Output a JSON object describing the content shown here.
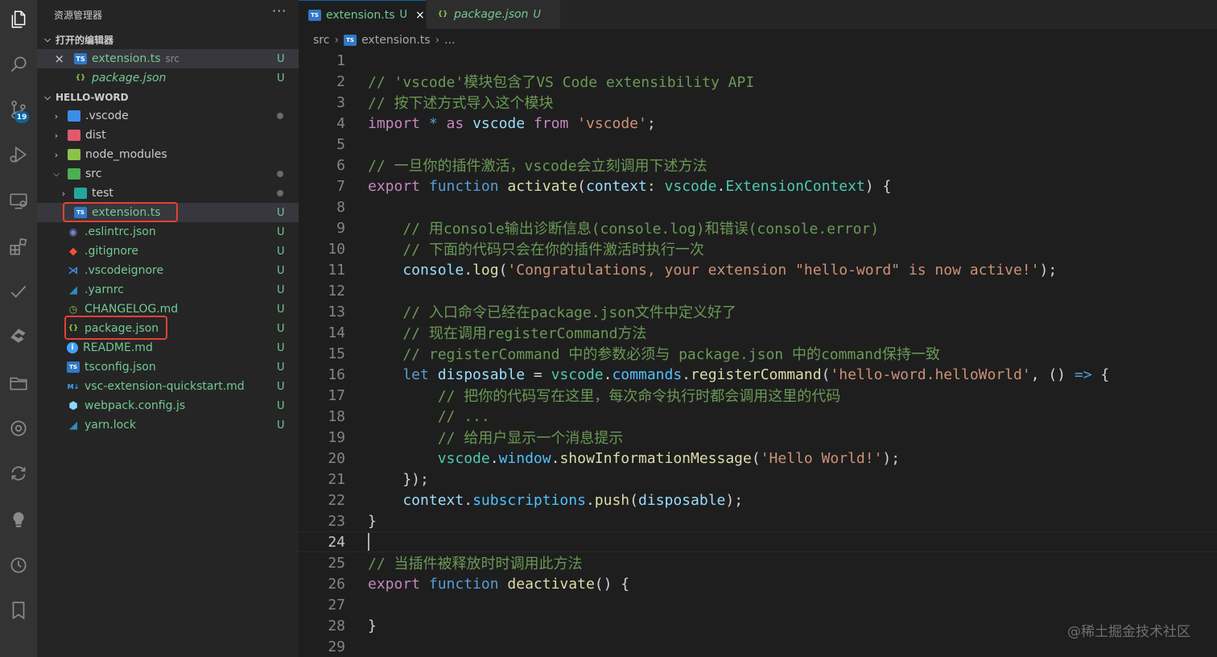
{
  "sidebar": {
    "title": "资源管理器",
    "more": "···",
    "open_editors": {
      "header": "打开的编辑器",
      "items": [
        {
          "close": "×",
          "icon": "TS",
          "name": "extension.ts",
          "hint": "src",
          "status": "U"
        },
        {
          "icon": "{}",
          "name": "package.json",
          "status": "U"
        }
      ]
    },
    "workspace": {
      "header": "HELLO-WORD",
      "items": [
        {
          "name": ".vscode",
          "status": ""
        },
        {
          "name": "dist",
          "status": ""
        },
        {
          "name": "node_modules",
          "status": ""
        },
        {
          "name": "src",
          "status": ""
        },
        {
          "name": "test",
          "status": ""
        },
        {
          "name": "extension.ts",
          "status": "U"
        },
        {
          "name": ".eslintrc.json",
          "status": "U"
        },
        {
          "name": ".gitignore",
          "status": "U"
        },
        {
          "name": ".vscodeignore",
          "status": "U"
        },
        {
          "name": ".yarnrc",
          "status": "U"
        },
        {
          "name": "CHANGELOG.md",
          "status": "U"
        },
        {
          "name": "package.json",
          "status": "U"
        },
        {
          "name": "README.md",
          "status": "U"
        },
        {
          "name": "tsconfig.json",
          "status": "U"
        },
        {
          "name": "vsc-extension-quickstart.md",
          "status": "U"
        },
        {
          "name": "webpack.config.js",
          "status": "U"
        },
        {
          "name": "yarn.lock",
          "status": "U"
        }
      ]
    }
  },
  "activity": {
    "badge": "19"
  },
  "tabs": [
    {
      "icon": "TS",
      "label": "extension.ts",
      "status": "U",
      "close": "×"
    },
    {
      "icon": "{}",
      "label": "package.json",
      "status": "U"
    }
  ],
  "breadcrumb": {
    "part1": "src",
    "part2": "extension.ts",
    "part3": "..."
  },
  "editor": {
    "line_numbers": [
      "1",
      "2",
      "3",
      "4",
      "5",
      "6",
      "7",
      "8",
      "9",
      "10",
      "11",
      "12",
      "13",
      "14",
      "15",
      "16",
      "17",
      "18",
      "19",
      "20",
      "21",
      "22",
      "23",
      "24",
      "25",
      "26",
      "27",
      "28",
      "29"
    ],
    "lines": {
      "l2": "// 'vscode'模块包含了VS Code extensibility API",
      "l3": "// 按下述方式导入这个模块",
      "l4_a": "import",
      "l4_b": " * ",
      "l4_c": "as",
      "l4_d": " vscode ",
      "l4_e": "from",
      "l4_f": " 'vscode'",
      "l4_g": ";",
      "l6": "// 一旦你的插件激活，vscode会立刻调用下述方法",
      "l7_a": "export",
      "l7_b": " function ",
      "l7_c": "activate",
      "l7_d": "(",
      "l7_e": "context",
      "l7_f": ": ",
      "l7_g": "vscode",
      "l7_h": ".",
      "l7_i": "ExtensionContext",
      "l7_j": ") {",
      "l9": "    // 用console输出诊断信息(console.log)和错误(console.error)",
      "l10": "    // 下面的代码只会在你的插件激活时执行一次",
      "l11_a": "    console",
      "l11_b": ".",
      "l11_c": "log",
      "l11_d": "(",
      "l11_e": "'Congratulations, your extension \"hello-word\" is now active!'",
      "l11_f": ");",
      "l13": "    // 入口命令已经在package.json文件中定义好了",
      "l14": "    // 现在调用registerCommand方法",
      "l15": "    // registerCommand 中的参数必须与 package.json 中的command保持一致",
      "l16_a": "    let",
      "l16_b": " disposable",
      "l16_c": " = ",
      "l16_d": "vscode",
      "l16_e": ".",
      "l16_f": "commands",
      "l16_g": ".",
      "l16_h": "registerCommand",
      "l16_i": "(",
      "l16_j": "'hello-word.helloWorld'",
      "l16_k": ", () ",
      "l16_l": "=>",
      "l16_m": " {",
      "l17": "        // 把你的代码写在这里，每次命令执行时都会调用这里的代码",
      "l18": "        // ...",
      "l19": "        // 给用户显示一个消息提示",
      "l20_a": "        vscode",
      "l20_b": ".",
      "l20_c": "window",
      "l20_d": ".",
      "l20_e": "showInformationMessage",
      "l20_f": "(",
      "l20_g": "'Hello World!'",
      "l20_h": ");",
      "l21": "    });",
      "l22_a": "    context",
      "l22_b": ".",
      "l22_c": "subscriptions",
      "l22_d": ".",
      "l22_e": "push",
      "l22_f": "(",
      "l22_g": "disposable",
      "l22_h": ");",
      "l23": "}",
      "l25": "// 当插件被释放时时调用此方法",
      "l26_a": "export",
      "l26_b": " function ",
      "l26_c": "deactivate",
      "l26_d": "() {",
      "l28": "}"
    }
  },
  "watermark": "@稀土掘金技术社区"
}
